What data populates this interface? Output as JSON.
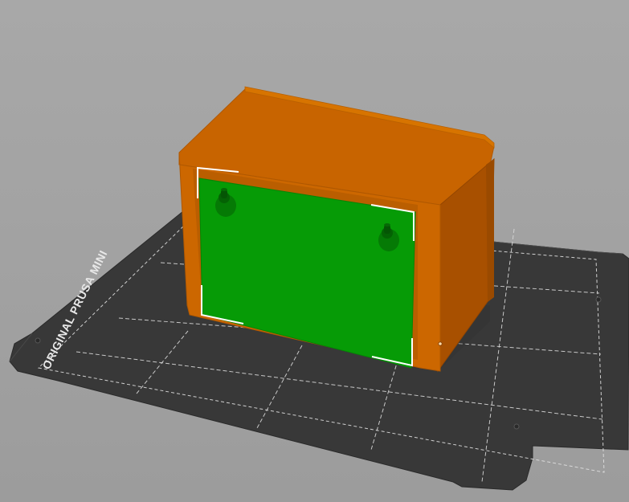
{
  "app": {
    "view": "3D viewport",
    "printer_bed_label": "ORIGINAL PRUSA MINI"
  },
  "scene": {
    "bed": {
      "color": "#3a3a3a",
      "grid_color": "#d8d8d8",
      "grid_style": "dashed"
    },
    "object": {
      "body_color": "#cf6b00",
      "side_color": "#b85c00",
      "shadow_color": "#a65200",
      "selected_face_color": "#069b06",
      "hardware": [
        "mounting-screw",
        "mounting-screw"
      ],
      "selection_box_color": "#ffffff"
    }
  }
}
